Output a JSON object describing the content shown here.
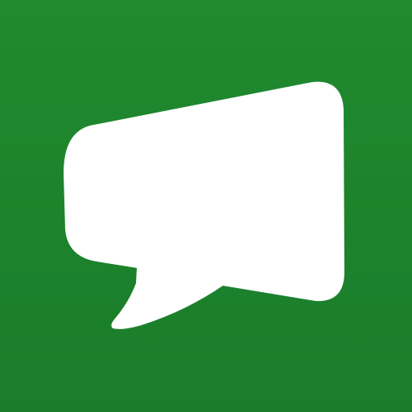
{
  "icon": {
    "name": "chat-bubble-icon",
    "background_color": "#1f8a2f",
    "bubble_color": "#ffffff"
  }
}
